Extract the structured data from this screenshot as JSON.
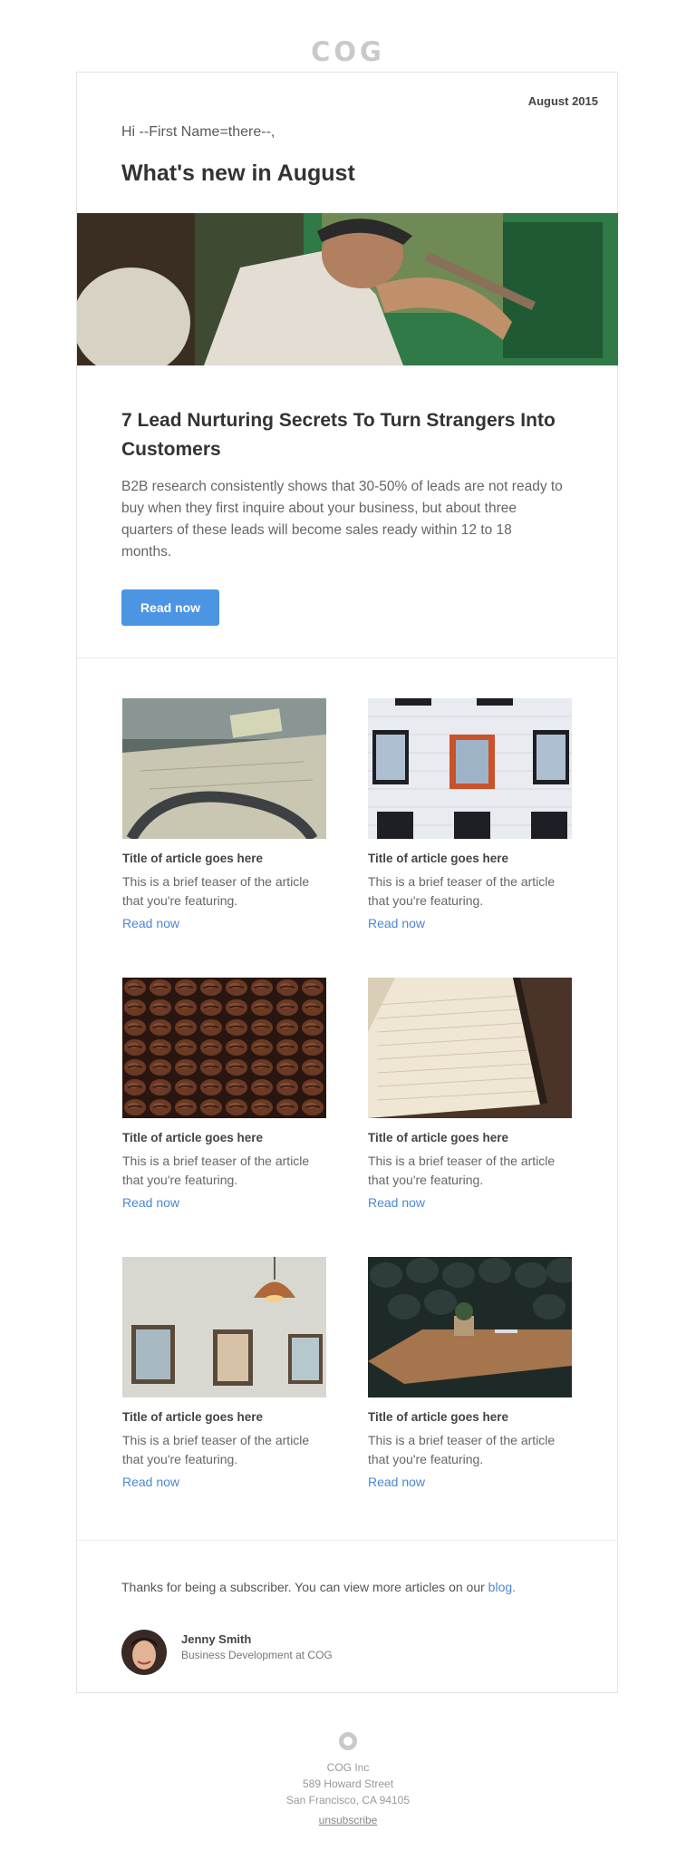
{
  "brand": {
    "logo_text": "COG"
  },
  "email": {
    "date": "August 2015",
    "greeting": "Hi --First Name=there--,",
    "headline": "What's new in August"
  },
  "feature": {
    "title": "7 Lead Nurturing Secrets To Turn Strangers Into Customers",
    "body": "B2B research consistently shows that 30-50% of leads are not ready to buy when they first inquire about your business, but about three quarters of these leads will become sales ready within 12 to 18 months.",
    "button_label": "Read now"
  },
  "articles": [
    {
      "title": "Title of article goes here",
      "teaser": "This is a brief teaser of the article that you're featuring.",
      "link": "Read now",
      "image": "map-desk-photo"
    },
    {
      "title": "Title of article goes here",
      "teaser": "This is a brief teaser of the article that you're featuring.",
      "link": "Read now",
      "image": "building-windows-photo"
    },
    {
      "title": "Title of article goes here",
      "teaser": "This is a brief teaser of the article that you're featuring.",
      "link": "Read now",
      "image": "coffee-beans-photo"
    },
    {
      "title": "Title of article goes here",
      "teaser": "This is a brief teaser of the article that you're featuring.",
      "link": "Read now",
      "image": "notebook-photo"
    },
    {
      "title": "Title of article goes here",
      "teaser": "This is a brief teaser of the article that you're featuring.",
      "link": "Read now",
      "image": "lamp-frames-photo"
    },
    {
      "title": "Title of article goes here",
      "teaser": "This is a brief teaser of the article that you're featuring.",
      "link": "Read now",
      "image": "cafe-table-photo"
    }
  ],
  "closing": {
    "text": "Thanks for being a subscriber. You can view more articles on our",
    "link": "blog."
  },
  "signature": {
    "name": "Jenny Smith",
    "role": "Business Development at COG"
  },
  "footer": {
    "company": "COG Inc",
    "street": "589 Howard Street",
    "city": "San Francisco, CA 94105",
    "unsubscribe": "unsubscribe"
  },
  "colors": {
    "accent": "#4b95e3",
    "link": "#4b86d6",
    "logo_gray": "#c9c9c9"
  }
}
